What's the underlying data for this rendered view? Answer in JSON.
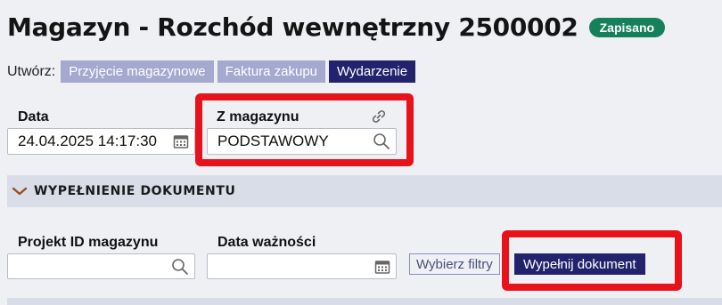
{
  "header": {
    "title": "Magazyn - Rozchód wewnętrzny 2500002",
    "status": "Zapisano",
    "status_color": "#15805a"
  },
  "create": {
    "label": "Utwórz:",
    "buttons": [
      "Przyjęcie magazynowe",
      "Faktura zakupu",
      "Wydarzenie"
    ]
  },
  "fields": {
    "date_label": "Data",
    "date_value": "24.04.2025 14:17:30",
    "warehouse_label": "Z magazynu",
    "warehouse_value": "PODSTAWOWY"
  },
  "section": {
    "title": "WYPEŁNIENIE DOKUMENTU",
    "project_label": "Projekt ID magazynu",
    "project_value": "",
    "expiry_label": "Data ważności",
    "expiry_value": "",
    "filter_button": "Wybierz filtry",
    "fill_button": "Wypełnij dokument"
  },
  "colors": {
    "primary": "#23236d",
    "secondary_button": "#a5a8cf",
    "highlight": "#e8121b",
    "section_bg": "#d8dde8"
  },
  "icons": [
    "calendar-icon",
    "link-icon",
    "search-icon",
    "chevron-down-icon"
  ]
}
